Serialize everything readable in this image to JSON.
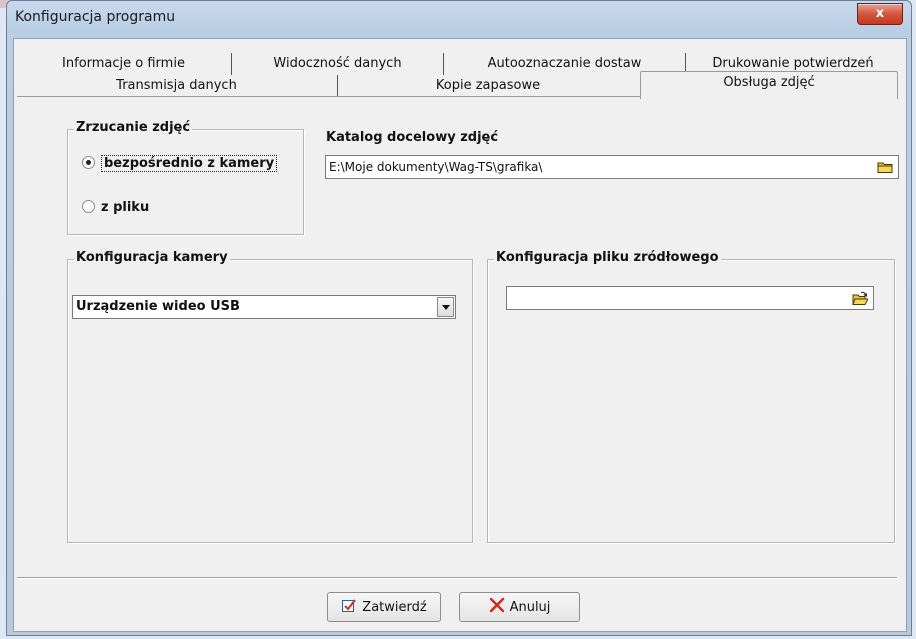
{
  "window": {
    "title": "Konfiguracja programu",
    "close_label": "x"
  },
  "tabs": {
    "row1": [
      {
        "label": "Informacje o firmie"
      },
      {
        "label": "Widoczność danych"
      },
      {
        "label": "Autooznaczanie dostaw"
      },
      {
        "label": "Drukowanie potwierdzeń"
      }
    ],
    "row2": [
      {
        "label": "Transmisja danych"
      },
      {
        "label": "Kopie zapasowe"
      },
      {
        "label": "Obsługa zdjęć",
        "active": true
      }
    ]
  },
  "photo_source": {
    "label": "Zrzucanie zdjęć",
    "options": [
      {
        "label": "bezpośrednio z kamery",
        "selected": true
      },
      {
        "label": "z pliku",
        "selected": false
      }
    ]
  },
  "target_dir": {
    "label": "Katalog docelowy zdjęć",
    "value": "E:\\Moje dokumenty\\Wag-TS\\grafika\\",
    "browse_icon": "folder-icon"
  },
  "camera_config": {
    "label": "Konfiguracja kamery",
    "device_selected": "Urządzenie wideo USB"
  },
  "source_file_config": {
    "label": "Konfiguracja pliku zródłowego",
    "value": "",
    "browse_icon": "folder-open-icon"
  },
  "buttons": {
    "confirm": "Zatwierdź",
    "cancel": "Anuluj"
  }
}
